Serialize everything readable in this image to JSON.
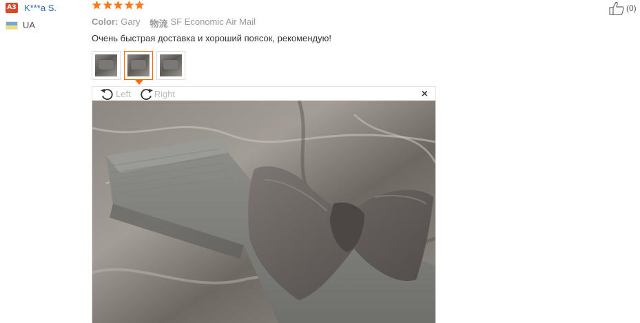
{
  "user": {
    "badge": "A3",
    "name": "K***a S.",
    "country": "UA"
  },
  "rating": {
    "stars": 5,
    "max": 5
  },
  "helpful": {
    "count": "(0)"
  },
  "meta": {
    "color_label": "Color:",
    "color_value": "Gary",
    "shipping_label": "物流",
    "shipping_value": "SF Economic Air Mail"
  },
  "review_text": "Очень быстрая доставка и хороший поясок, рекомендую!",
  "thumbnails": [
    {
      "selected": false
    },
    {
      "selected": true
    },
    {
      "selected": false
    }
  ],
  "viewer": {
    "rotate_left_label": "Left",
    "rotate_right_label": "Right",
    "close_label": "×"
  },
  "colors": {
    "accent": "#ff6a00",
    "star": "#ff7a1a",
    "link": "#2d64b3",
    "badge": "#d94a2a"
  }
}
